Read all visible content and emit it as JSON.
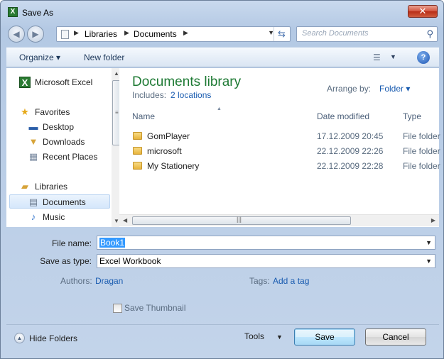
{
  "window": {
    "title": "Save As",
    "close_glyph": "✕"
  },
  "address": {
    "crumbs": [
      "Libraries",
      "Documents"
    ],
    "search_placeholder": "Search Documents"
  },
  "toolbar": {
    "organize": "Organize",
    "new_folder": "New folder",
    "help": "?"
  },
  "nav": {
    "items": [
      {
        "label": "Microsoft Excel",
        "icon": "excel-icon"
      },
      {
        "label": "Favorites",
        "icon": "star-icon"
      },
      {
        "label": "Desktop",
        "icon": "desktop-icon"
      },
      {
        "label": "Downloads",
        "icon": "downloads-icon"
      },
      {
        "label": "Recent Places",
        "icon": "recent-places-icon"
      },
      {
        "label": "Libraries",
        "icon": "libraries-icon"
      },
      {
        "label": "Documents",
        "icon": "documents-icon"
      },
      {
        "label": "Music",
        "icon": "music-icon"
      }
    ]
  },
  "library": {
    "title": "Documents library",
    "includes_label": "Includes:",
    "includes_link": "2 locations",
    "arrange_label": "Arrange by:",
    "arrange_value": "Folder"
  },
  "columns": {
    "name": "Name",
    "date": "Date modified",
    "type": "Type"
  },
  "files": [
    {
      "name": "GomPlayer",
      "date": "17.12.2009 20:45",
      "type": "File folder"
    },
    {
      "name": "microsoft",
      "date": "22.12.2009 22:26",
      "type": "File folder"
    },
    {
      "name": "My Stationery",
      "date": "22.12.2009 22:28",
      "type": "File folder"
    }
  ],
  "form": {
    "file_name_label": "File name:",
    "file_name_value": "Book1",
    "save_type_label": "Save as type:",
    "save_type_value": "Excel Workbook",
    "authors_label": "Authors:",
    "authors_value": "Dragan",
    "tags_label": "Tags:",
    "tags_value": "Add a tag",
    "thumbnail_label": "Save Thumbnail",
    "thumbnail_checked": false
  },
  "footer": {
    "hide_folders": "Hide Folders",
    "tools": "Tools",
    "save": "Save",
    "cancel": "Cancel"
  },
  "colors": {
    "accent_green": "#1e7a34",
    "link_blue": "#1a5cb0",
    "close_red": "#c4412a"
  }
}
